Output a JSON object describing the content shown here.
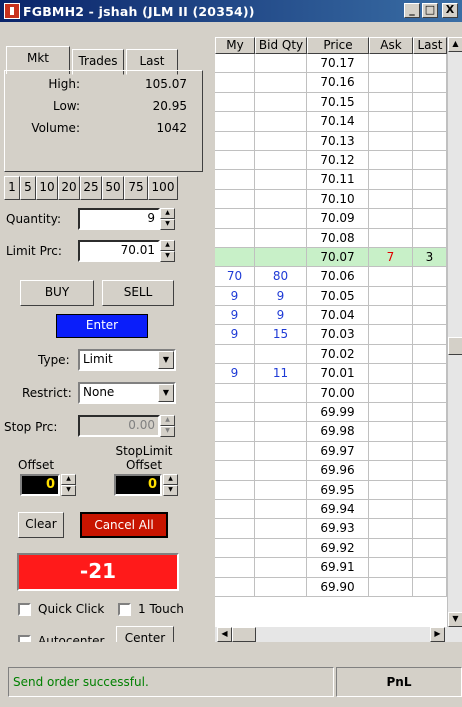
{
  "window": {
    "title": "FGBMH2 - jshah (JLM II (20354))",
    "minimize": "_",
    "maximize": "□",
    "close": "X"
  },
  "tabs": [
    "Mkt",
    "Trades",
    "Last"
  ],
  "market": {
    "high_label": "High:",
    "high": "105.07",
    "low_label": "Low:",
    "low": "20.95",
    "volume_label": "Volume:",
    "volume": "1042"
  },
  "quantity_buttons": [
    "1",
    "5",
    "10",
    "20",
    "25",
    "50",
    "75",
    "100"
  ],
  "order": {
    "quantity_label": "Quantity:",
    "quantity": "9",
    "limit_label": "Limit Prc:",
    "limit": "70.01",
    "buy_label": "BUY",
    "sell_label": "SELL",
    "enter_label": "Enter",
    "type_label": "Type:",
    "type": "Limit",
    "restrict_label": "Restrict:",
    "restrict": "None",
    "stop_label": "Stop Prc:",
    "stop": "0.00",
    "offset_label": "Offset",
    "offset": "0",
    "stoplimit_label": "StopLimit Offset",
    "stoplimit_offset": "0",
    "clear_label": "Clear",
    "cancel_all_label": "Cancel All",
    "pnl_value": "-21",
    "quick_click_label": "Quick Click",
    "one_touch_label": "1 Touch",
    "autocenter_label": "Autocenter",
    "center_label": "Center"
  },
  "grid": {
    "columns": [
      "My",
      "Bid Qty",
      "Price",
      "Ask",
      "Last"
    ],
    "rows": [
      {
        "my": "",
        "bid": "",
        "price": "70.17",
        "ask": "",
        "last": ""
      },
      {
        "my": "",
        "bid": "",
        "price": "70.16",
        "ask": "",
        "last": ""
      },
      {
        "my": "",
        "bid": "",
        "price": "70.15",
        "ask": "",
        "last": ""
      },
      {
        "my": "",
        "bid": "",
        "price": "70.14",
        "ask": "",
        "last": ""
      },
      {
        "my": "",
        "bid": "",
        "price": "70.13",
        "ask": "",
        "last": ""
      },
      {
        "my": "",
        "bid": "",
        "price": "70.12",
        "ask": "",
        "last": ""
      },
      {
        "my": "",
        "bid": "",
        "price": "70.11",
        "ask": "",
        "last": ""
      },
      {
        "my": "",
        "bid": "",
        "price": "70.10",
        "ask": "",
        "last": ""
      },
      {
        "my": "",
        "bid": "",
        "price": "70.09",
        "ask": "",
        "last": ""
      },
      {
        "my": "",
        "bid": "",
        "price": "70.08",
        "ask": "",
        "last": ""
      },
      {
        "my": "",
        "bid": "",
        "price": "70.07",
        "ask": "7",
        "last": "3",
        "highlight": true
      },
      {
        "my": "70",
        "bid": "80",
        "price": "70.06",
        "ask": "",
        "last": ""
      },
      {
        "my": "9",
        "bid": "9",
        "price": "70.05",
        "ask": "",
        "last": ""
      },
      {
        "my": "9",
        "bid": "9",
        "price": "70.04",
        "ask": "",
        "last": ""
      },
      {
        "my": "9",
        "bid": "15",
        "price": "70.03",
        "ask": "",
        "last": ""
      },
      {
        "my": "",
        "bid": "",
        "price": "70.02",
        "ask": "",
        "last": ""
      },
      {
        "my": "9",
        "bid": "11",
        "price": "70.01",
        "ask": "",
        "last": ""
      },
      {
        "my": "",
        "bid": "",
        "price": "70.00",
        "ask": "",
        "last": ""
      },
      {
        "my": "",
        "bid": "",
        "price": "69.99",
        "ask": "",
        "last": ""
      },
      {
        "my": "",
        "bid": "",
        "price": "69.98",
        "ask": "",
        "last": ""
      },
      {
        "my": "",
        "bid": "",
        "price": "69.97",
        "ask": "",
        "last": ""
      },
      {
        "my": "",
        "bid": "",
        "price": "69.96",
        "ask": "",
        "last": ""
      },
      {
        "my": "",
        "bid": "",
        "price": "69.95",
        "ask": "",
        "last": ""
      },
      {
        "my": "",
        "bid": "",
        "price": "69.94",
        "ask": "",
        "last": ""
      },
      {
        "my": "",
        "bid": "",
        "price": "69.93",
        "ask": "",
        "last": ""
      },
      {
        "my": "",
        "bid": "",
        "price": "69.92",
        "ask": "",
        "last": ""
      },
      {
        "my": "",
        "bid": "",
        "price": "69.91",
        "ask": "",
        "last": ""
      },
      {
        "my": "",
        "bid": "",
        "price": "69.90",
        "ask": "",
        "last": ""
      }
    ]
  },
  "status": {
    "message": "Send order successful.",
    "pnl_label": "PnL"
  },
  "colors": {
    "enter": "#0a1efa",
    "cancel_all": "#c81400",
    "pnl_box": "#ff1a1a",
    "highlight_row": "#c8f0c8",
    "bid_text": "#1f3bd6",
    "ask_text": "#e00000"
  }
}
